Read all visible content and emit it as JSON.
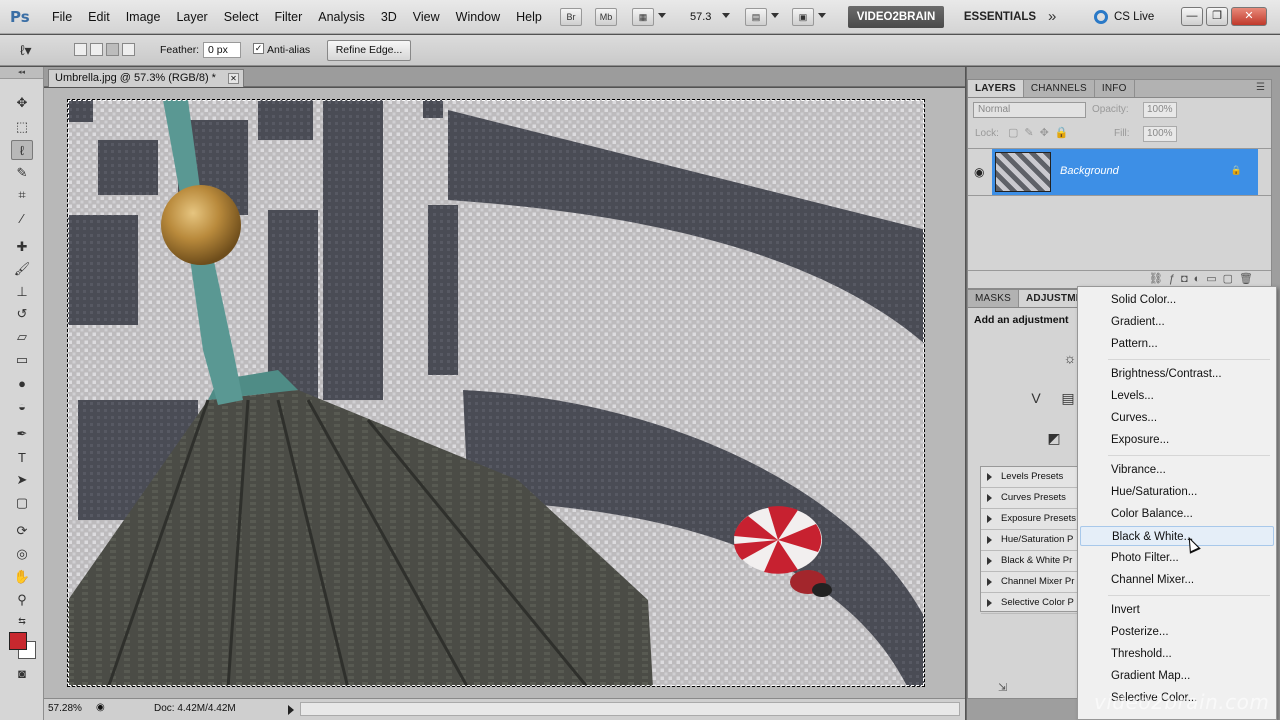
{
  "app": {
    "logo": "Ps",
    "menus": [
      "File",
      "Edit",
      "Image",
      "Layer",
      "Select",
      "Filter",
      "Analysis",
      "3D",
      "View",
      "Window",
      "Help"
    ],
    "bridge_btn": "Br",
    "minibridge_btn": "Mb",
    "zoom": "57.3",
    "workspace_active": "VIDEO2BRAIN",
    "workspace_other": "ESSENTIALS",
    "workspace_more": "»",
    "cs_live": "CS Live",
    "window_buttons": {
      "min": "—",
      "max": "❐",
      "close": "✕"
    }
  },
  "options": {
    "feather_label": "Feather:",
    "feather_value": "0 px",
    "antialias_label": "Anti-alias",
    "antialias_checked": "✓",
    "refine_edge": "Refine Edge..."
  },
  "tools": {
    "colors": {
      "foreground": "#c8282e",
      "background": "#ffffff"
    }
  },
  "document": {
    "tab_title": "Umbrella.jpg @ 57.3% (RGB/8) *",
    "zoom_status": "57.28%",
    "doc_info": "Doc: 4.42M/4.42M"
  },
  "layers_panel": {
    "tabs": [
      "LAYERS",
      "CHANNELS",
      "INFO"
    ],
    "blend_mode": "Normal",
    "opacity_label": "Opacity:",
    "opacity_value": "100%",
    "lock_label": "Lock:",
    "fill_label": "Fill:",
    "fill_value": "100%",
    "layer_name": "Background",
    "selected_color": "#3d8fe6"
  },
  "adjustments_panel": {
    "tabs": [
      "MASKS",
      "ADJUSTME"
    ],
    "title": "Add an adjustment",
    "presets": [
      "Levels Presets",
      "Curves Presets",
      "Exposure Presets",
      "Hue/Saturation P",
      "Black & White Pr",
      "Channel Mixer Pr",
      "Selective Color P"
    ]
  },
  "adjustment_menu": {
    "groups": [
      [
        "Solid Color...",
        "Gradient...",
        "Pattern..."
      ],
      [
        "Brightness/Contrast...",
        "Levels...",
        "Curves...",
        "Exposure..."
      ],
      [
        "Vibrance...",
        "Hue/Saturation...",
        "Color Balance...",
        "Black & White...",
        "Photo Filter...",
        "Channel Mixer..."
      ],
      [
        "Invert",
        "Posterize...",
        "Threshold...",
        "Gradient Map...",
        "Selective Color..."
      ]
    ],
    "hovered": "Black & White..."
  },
  "watermark": "video2brain.com"
}
